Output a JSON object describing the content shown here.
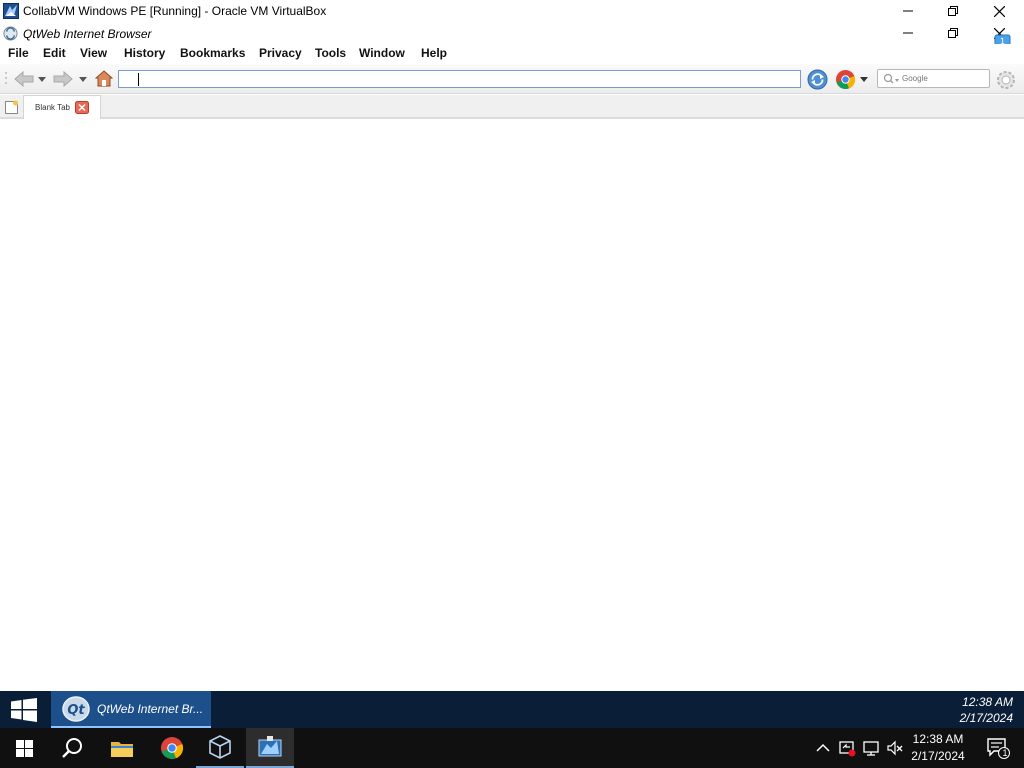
{
  "vbox": {
    "title": "CollabVM Windows PE [Running] - Oracle VM VirtualBox"
  },
  "qtweb": {
    "title": "QtWeb Internet Browser",
    "menu": [
      "File",
      "Edit",
      "View",
      "History",
      "Bookmarks",
      "Privacy",
      "Tools",
      "Window",
      "Help"
    ],
    "url_value": "",
    "search_placeholder": "Google",
    "tab_label": "Blank Tab"
  },
  "guest_taskbar": {
    "task_label": "QtWeb Internet Br...",
    "time": "12:38 AM",
    "date": "2/17/2024"
  },
  "host_taskbar": {
    "time": "12:38 AM",
    "date": "2/17/2024",
    "notification_count": "1"
  },
  "colors": {
    "guest_taskbar": "#0b1e38",
    "guest_task_active": "#1d4f8a",
    "host_taskbar": "#101010",
    "url_border": "#7a9cd3"
  }
}
